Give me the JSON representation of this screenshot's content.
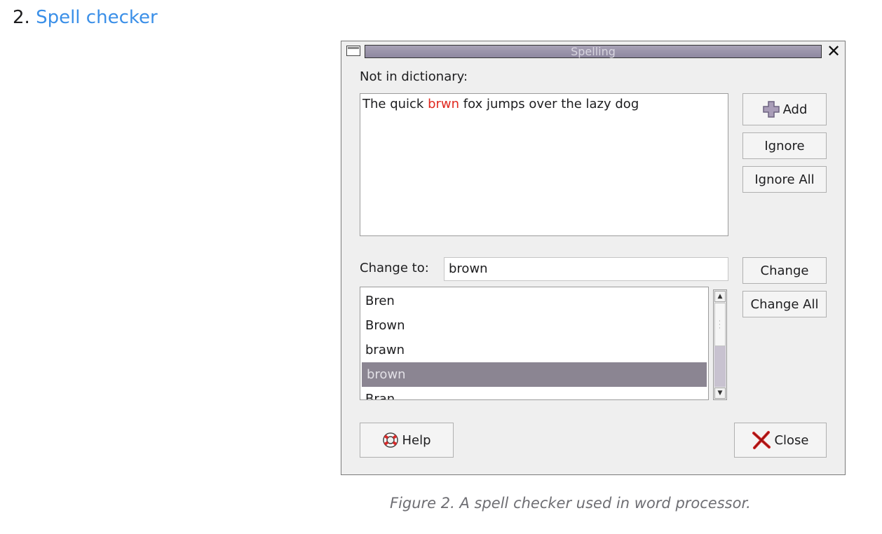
{
  "heading": {
    "number": "2.",
    "link": "Spell checker"
  },
  "dialog": {
    "title": "Spelling",
    "not_in_dictionary_label": "Not in dictionary:",
    "sentence": {
      "before": "The quick ",
      "misspelled": "brwn",
      "after": " fox jumps over the lazy dog"
    },
    "buttons": {
      "add": "Add",
      "ignore": "Ignore",
      "ignore_all": "Ignore All",
      "change": "Change",
      "change_all": "Change All",
      "help": "Help",
      "close": "Close"
    },
    "change_to_label": "Change to:",
    "change_to_value": "brown",
    "suggestions": [
      {
        "word": "Bren",
        "selected": false
      },
      {
        "word": "Brown",
        "selected": false
      },
      {
        "word": "brawn",
        "selected": false
      },
      {
        "word": "brown",
        "selected": true
      },
      {
        "word": "Bran",
        "selected": false
      }
    ]
  },
  "caption": "Figure 2. A spell checker used in word processor."
}
